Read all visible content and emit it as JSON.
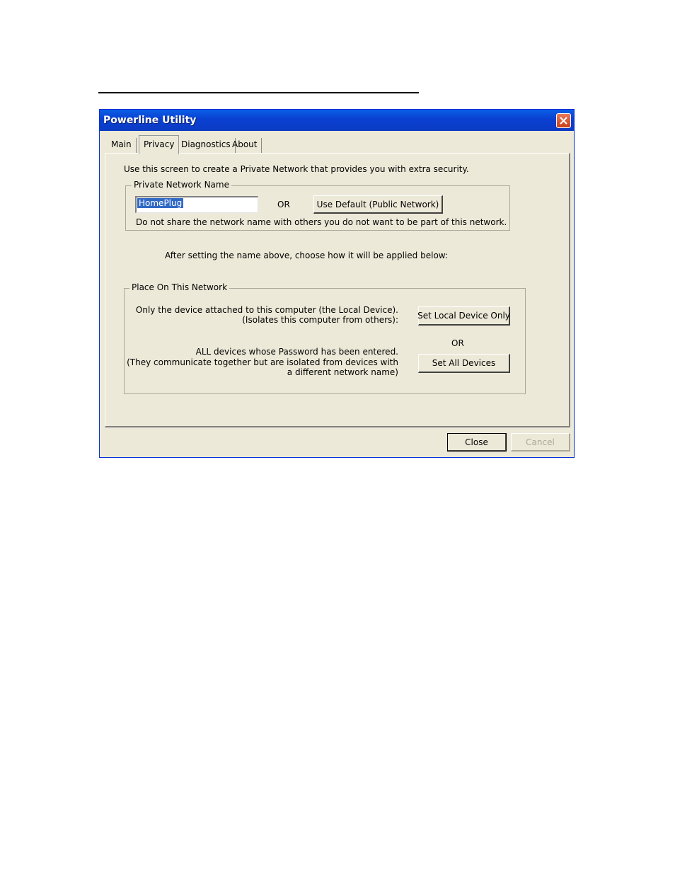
{
  "window": {
    "title": "Powerline Utility"
  },
  "icons": {
    "close": "close-icon"
  },
  "tabs": [
    {
      "label": "Main"
    },
    {
      "label": "Privacy",
      "active": true
    },
    {
      "label": "Diagnostics"
    },
    {
      "label": "About"
    }
  ],
  "privacy": {
    "intro": "Use this screen to create a Private Network that provides you with extra security.",
    "network_name_group": {
      "legend": "Private Network Name",
      "name_value": "HomePlug",
      "or_label": "OR",
      "default_button": "Use Default (Public Network)",
      "warning": "Do not share the network name with others you do not want to be part of this network."
    },
    "apply_instruction": "After setting the name above, choose how it will be applied below:",
    "place_group": {
      "legend": "Place On This Network",
      "local_line1": "Only the device attached to this computer (the Local Device).",
      "local_line2": "(Isolates this computer from others):",
      "local_button": "Set Local Device Only",
      "or_label": "OR",
      "all_line1": "ALL devices whose Password has been entered.",
      "all_line2": "(They communicate together but are isolated from devices with",
      "all_line3": "a different network name)",
      "all_button": "Set All Devices"
    }
  },
  "footer": {
    "close_button": "Close",
    "cancel_button": "Cancel"
  }
}
